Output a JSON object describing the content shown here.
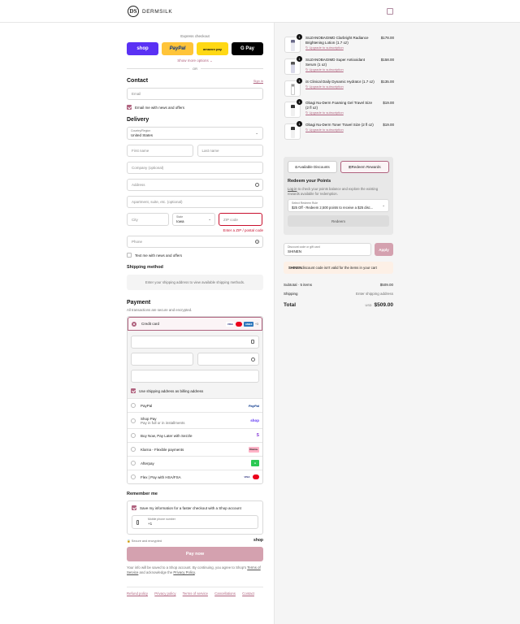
{
  "header": {
    "logo_mark": "DS",
    "brand": "DERMSILK",
    "cart_icon": "bag-icon"
  },
  "express": {
    "label": "Express checkout",
    "buttons": [
      {
        "label": "shop",
        "bg": "#5a31f4",
        "fg": "#ffffff"
      },
      {
        "label": "PayPal",
        "bg": "#ffc439",
        "fg": "#003087"
      },
      {
        "label": "amazon pay",
        "bg": "#ffd814",
        "fg": "#111111"
      },
      {
        "label": "G Pay",
        "bg": "#000000",
        "fg": "#ffffff"
      }
    ],
    "more": "Show more options",
    "or": "OR"
  },
  "contact": {
    "title": "Contact",
    "sign_in": "Sign in",
    "email_placeholder": "Email",
    "news_label": "Email me with news and offers"
  },
  "delivery": {
    "title": "Delivery",
    "country_label": "Country/Region",
    "country_value": "United States",
    "first_name": "First name",
    "last_name": "Last name",
    "company": "Company (optional)",
    "address": "Address",
    "apartment": "Apartment, suite, etc. (optional)",
    "city": "City",
    "state_label": "State",
    "state_value": "Iowa",
    "zip": "ZIP code",
    "zip_error": "Enter a ZIP / postal code",
    "phone": "Phone",
    "text_label": "Text me with news and offers"
  },
  "shipping": {
    "title": "Shipping method",
    "placeholder": "Enter your shipping address to view available shipping methods."
  },
  "payment": {
    "title": "Payment",
    "subtitle": "All transactions are secure and encrypted.",
    "credit_card": "Credit card",
    "card_logos": [
      "VISA",
      "MC",
      "AMEX",
      "+3"
    ],
    "billing_same": "Use shipping address as billing address",
    "methods": [
      {
        "label": "PayPal",
        "sub": "",
        "logo": "PayPal"
      },
      {
        "label": "Shop Pay",
        "sub": "Pay in full or in installments",
        "logo": "shop"
      },
      {
        "label": "Buy Now, Pay Later with Sezzle",
        "sub": "",
        "logo": "S"
      },
      {
        "label": "Klarna - Flexible payments",
        "sub": "",
        "logo": "Klarna."
      },
      {
        "label": "Afterpay",
        "sub": "",
        "logo": "A"
      },
      {
        "label": "Flex | Pay with HSA/FSA",
        "sub": "",
        "logo": "VISA"
      }
    ]
  },
  "remember": {
    "title": "Remember me",
    "save_label": "Save my information for a faster checkout with a Shop account",
    "phone_label": "Mobile phone number",
    "phone_value": "+1",
    "secure": "Secure and encrypted",
    "shop": "shop"
  },
  "pay_now": "Pay now",
  "disclaimer": {
    "line1": "Your info will be saved to a Shop account. By continuing, you agree to Shop's",
    "terms": "Terms of Service",
    "and": " and acknowledge the ",
    "privacy": "Privacy Policy",
    "end": "."
  },
  "footer_links": [
    "Refund policy",
    "Privacy policy",
    "Terms of service",
    "Cancellations",
    "Contact"
  ],
  "products": [
    {
      "qty": "1",
      "name": "SUZANOBAGIMD Clarbright Radiance Brightening Lotion (1.7 oz)",
      "price": "$178.00",
      "upgrade": "Upgrade to subscription"
    },
    {
      "qty": "1",
      "name": "SUZANOBAGIMD Super Antioxidant Serum (1 oz)",
      "price": "$158.00",
      "upgrade": "Upgrade to subscription"
    },
    {
      "qty": "1",
      "name": "iS Clinical Daily Dynamic Hydrator (1.7 oz)",
      "price": "$135.00",
      "upgrade": "Upgrade to subscription"
    },
    {
      "qty": "1",
      "name": "Obagi Nu-Derm Foaming Gel Travel Size (2 fl oz)",
      "price": "$19.00",
      "upgrade": "Upgrade to subscription"
    },
    {
      "qty": "1",
      "name": "Obagi Nu-Derm Toner Travel Size (2 fl oz)",
      "price": "$19.00",
      "upgrade": "Upgrade to subscription"
    }
  ],
  "rewards": {
    "discounts_tab": "Available Discounts",
    "redeem_tab": "Redeem Rewards",
    "title": "Redeem your Points",
    "login": "Log in",
    "login_rest": " to check your points balance and explore the existing rewards available for redemption.",
    "select_label": "Select Redeem Rule",
    "select_value": "$25 Off - Redeem 2,500 points to receive a $25 disc...",
    "redeem_btn": "Redeem"
  },
  "discount": {
    "label": "Discount code or gift card",
    "value": "SHINEN",
    "apply": "Apply",
    "error_code": "SHINEN",
    "error_rest": " discount code isn't valid for the items in your cart"
  },
  "summary": {
    "subtotal_label": "Subtotal · 5 items",
    "subtotal": "$509.00",
    "shipping_label": "Shipping",
    "shipping": "Enter shipping address",
    "total_label": "Total",
    "currency": "USD",
    "total": "$509.00"
  },
  "colors": {
    "accent": "#b0637f",
    "pay_button": "#d4a1af",
    "error": "#c8102e"
  }
}
